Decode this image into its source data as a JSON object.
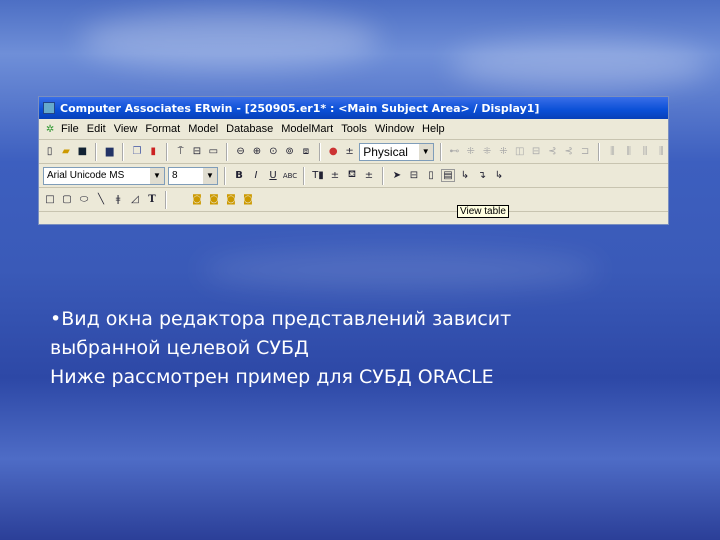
{
  "window": {
    "title": "Computer Associates ERwin - [250905.er1* : <Main Subject Area> / Display1]",
    "menu": [
      "File",
      "Edit",
      "View",
      "Format",
      "Model",
      "Database",
      "ModelMart",
      "Tools",
      "Window",
      "Help"
    ],
    "view_mode": "Physical",
    "font_name": "Arial Unicode MS",
    "font_size": "8",
    "tooltip": "View table"
  },
  "slide": {
    "lines": [
      "•Вид окна редактора представлений зависит",
      "выбранной целевой СУБД",
      "Ниже рассмотрен пример для СУБД ORACLE"
    ]
  }
}
